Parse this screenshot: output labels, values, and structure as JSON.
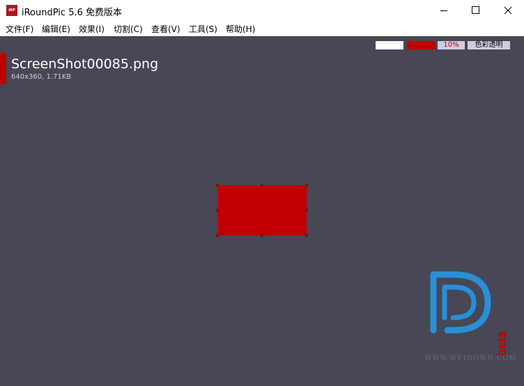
{
  "window": {
    "icon_text": "iRP",
    "title": "iRoundPic 5.6 免费版本"
  },
  "menu": [
    {
      "label": "文件(F)"
    },
    {
      "label": "编辑(E)"
    },
    {
      "label": "效果(I)"
    },
    {
      "label": "切割(C)"
    },
    {
      "label": "查看(V)"
    },
    {
      "label": "工具(S)"
    },
    {
      "label": "帮助(H)"
    }
  ],
  "toolbar": {
    "background_color": "#ffffff",
    "fill_color": "#c00000",
    "percent": "10%",
    "transparent_label": "色彩透明"
  },
  "file": {
    "name": "ScreenShot00085.png",
    "info": "640x360, 1.71KB"
  },
  "watermark": {
    "badge": "beta",
    "url": "WWW.WEIDOWN.COM"
  },
  "colors": {
    "canvas": "#474755",
    "accent": "#c00000",
    "watermark_blue": "#2a8fd6"
  }
}
